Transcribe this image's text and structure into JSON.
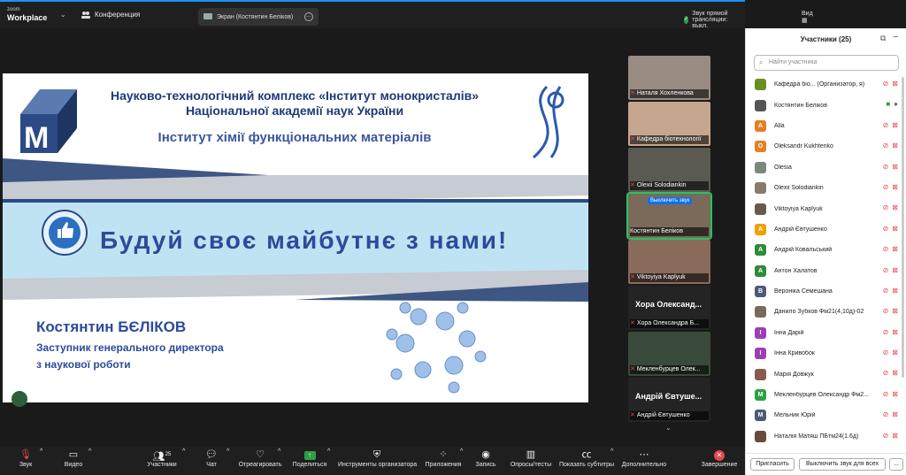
{
  "topbar": {
    "logo_small": "zoom",
    "logo_big": "Workplace",
    "conference": "Конференция",
    "screen_share": "Экран (Костянтин Беліков)",
    "audio_status": "Звук прямой трансляции: выкл.",
    "view": "Вид"
  },
  "slide": {
    "line1": "Науково-технологічний комплекс «Інститут монокристалів»",
    "line2": "Національної академії наук України",
    "line3": "Інститут хімії функціональних матеріалів",
    "slogan": "Будуй своє майбутнє з нами!",
    "presenter_name": "Костянтин БЄЛІКОВ",
    "role_line1": "Заступник генерального директора",
    "role_line2": "з наукової роботи"
  },
  "video_strip": [
    {
      "name": "Наталя Хохленкова",
      "muted": true
    },
    {
      "name": "Кафедра біотехнології",
      "muted": true
    },
    {
      "name": "Olexii Solodiankin",
      "muted": true
    },
    {
      "name": "Костянтин Беліков",
      "muted": false,
      "hover": "Выключить звук"
    },
    {
      "name": "Viktoyiya Kaplyuk",
      "muted": true
    },
    {
      "big_name": "Хора Олександ...",
      "name": "Хора Олександра Б...",
      "muted": true
    },
    {
      "name": "Мекленбурцев Олек...",
      "muted": true
    },
    {
      "big_name": "Андрій Євтуше...",
      "name": "Андрій Євтушенко",
      "muted": true
    }
  ],
  "panel": {
    "title": "Участники (25)",
    "search_placeholder": "Найти участника",
    "participants": [
      {
        "initial": "",
        "name": "Кафедра біо...  (Организатор, я)",
        "color": "#6b8e23",
        "mic_on": false,
        "cam_on": false
      },
      {
        "initial": "",
        "name": "Костянтин Беліков",
        "color": "#555555",
        "mic_on": true,
        "cam_on": true
      },
      {
        "initial": "A",
        "name": "Alla",
        "color": "#e67e22",
        "mic_on": false,
        "cam_on": false
      },
      {
        "initial": "O",
        "name": "Oleksandr Kukhtenko",
        "color": "#e67e22",
        "mic_on": false,
        "cam_on": false
      },
      {
        "initial": "",
        "name": "Olesia",
        "color": "#7a8a7a",
        "mic_on": false,
        "cam_on": false
      },
      {
        "initial": "",
        "name": "Olexii Solodiankin",
        "color": "#8a7a6a",
        "mic_on": false,
        "cam_on": false
      },
      {
        "initial": "",
        "name": "Viktoyiya Kaplyuk",
        "color": "#6a5a4a",
        "mic_on": false,
        "cam_on": false
      },
      {
        "initial": "A",
        "name": "Андрій Євтушенко",
        "color": "#f0a000",
        "mic_on": false,
        "cam_on": false
      },
      {
        "initial": "A",
        "name": "Андрій Ковальський",
        "color": "#2e8b3a",
        "mic_on": false,
        "cam_on": false
      },
      {
        "initial": "A",
        "name": "Антон Халатов",
        "color": "#2e8b3a",
        "mic_on": false,
        "cam_on": false
      },
      {
        "initial": "B",
        "name": "Вероніка Семешана",
        "color": "#4a5a7a",
        "mic_on": false,
        "cam_on": false
      },
      {
        "initial": "",
        "name": "Данило Зубков Фм21(4,10д)-02",
        "color": "#7a6a5a",
        "mic_on": false,
        "cam_on": false
      },
      {
        "initial": "I",
        "name": "Інна Дарій",
        "color": "#9b3fb5",
        "mic_on": false,
        "cam_on": false
      },
      {
        "initial": "I",
        "name": "Інна Кривобок",
        "color": "#9b3fb5",
        "mic_on": false,
        "cam_on": false
      },
      {
        "initial": "",
        "name": "Марія Довжук",
        "color": "#8a5a4a",
        "mic_on": false,
        "cam_on": false
      },
      {
        "initial": "M",
        "name": "Мекленбурцев Олександр Фм2...",
        "color": "#2ea043",
        "mic_on": false,
        "cam_on": false
      },
      {
        "initial": "M",
        "name": "Мельник Юрій",
        "color": "#4a5a7a",
        "mic_on": false,
        "cam_on": false
      },
      {
        "initial": "",
        "name": "Наталія Матяш ПБтм24(1.6д)",
        "color": "#6a4a3a",
        "mic_on": false,
        "cam_on": false
      }
    ],
    "invite": "Пригласить",
    "mute_all": "Выключить звук для всех",
    "more": "..."
  },
  "toolbar": {
    "audio": "Звук",
    "video": "Видео",
    "participants": "Участники",
    "participants_count": "25",
    "chat": "Чат",
    "react": "Отреагировать",
    "share": "Поделиться",
    "host_tools": "Инструменты организатора",
    "apps": "Приложения",
    "record": "Запись",
    "polls": "Опросы/тесты",
    "captions": "Показать субтитры",
    "more": "Дополнительно",
    "end": "Завершение"
  }
}
